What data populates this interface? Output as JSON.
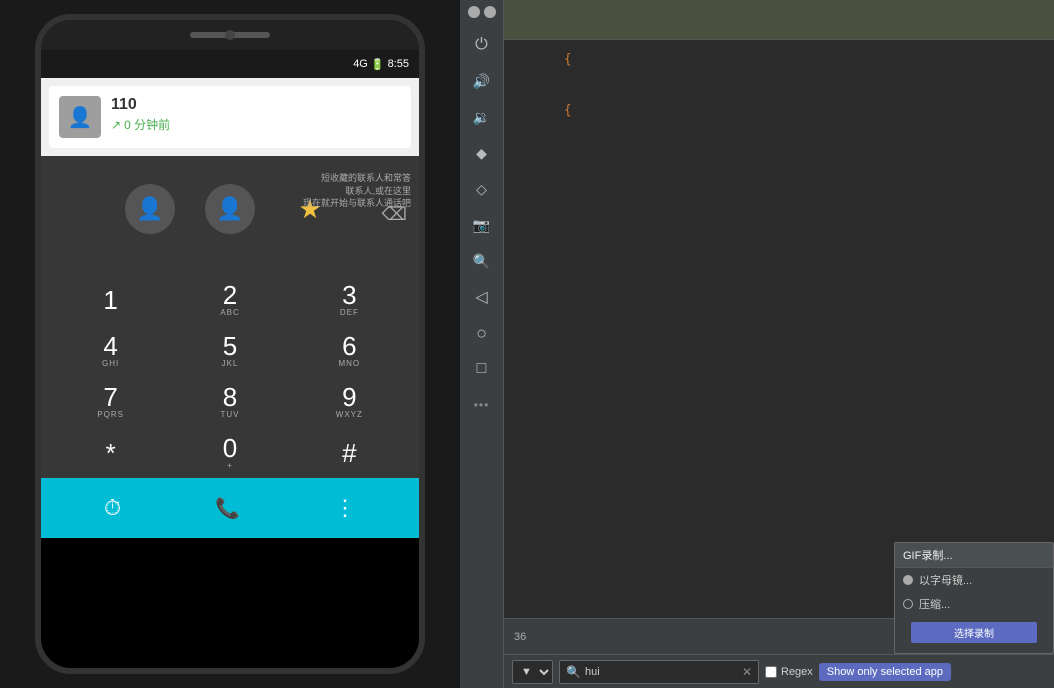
{
  "phone": {
    "status_bar": {
      "time": "8:55",
      "icons": "4G ▪ 🔋"
    },
    "notification": {
      "caller_number": "110",
      "time_ago": "0 分钟前",
      "avatar_icon": "👤"
    },
    "dialpad": {
      "overlay_text_line1": "短收藏的联系人和常答",
      "overlay_text_line2": "联系人,或在这里",
      "overlay_text_line3": "现在就开始与联系人通话吧",
      "keys": [
        {
          "num": "1",
          "letters": ""
        },
        {
          "num": "2",
          "letters": "ABC"
        },
        {
          "num": "3",
          "letters": "DEF"
        },
        {
          "num": "4",
          "letters": "GHI"
        },
        {
          "num": "5",
          "letters": "JKL"
        },
        {
          "num": "6",
          "letters": "MNO"
        },
        {
          "num": "7",
          "letters": "PQRS"
        },
        {
          "num": "8",
          "letters": "TUV"
        },
        {
          "num": "9",
          "letters": "WXYZ"
        },
        {
          "num": "*",
          "letters": ""
        },
        {
          "num": "0",
          "letters": "+"
        },
        {
          "num": "#",
          "letters": ""
        }
      ]
    },
    "bottom_bar": {
      "left_icon": "⏱",
      "center_icon": "📞",
      "right_icon": "⋮"
    }
  },
  "ide": {
    "toolbar": {
      "minimize_label": "–",
      "close_label": "✕",
      "icons": [
        {
          "name": "power-icon",
          "symbol": "⏻"
        },
        {
          "name": "volume-up-icon",
          "symbol": "🔊"
        },
        {
          "name": "volume-down-icon",
          "symbol": "🔉"
        },
        {
          "name": "diamond-icon",
          "symbol": "◆"
        },
        {
          "name": "eraser-icon",
          "symbol": "◇"
        },
        {
          "name": "camera-icon",
          "symbol": "📷"
        },
        {
          "name": "zoom-in-icon",
          "symbol": "🔍"
        },
        {
          "name": "back-icon",
          "symbol": "◁"
        },
        {
          "name": "home-icon",
          "symbol": "○"
        },
        {
          "name": "square-icon",
          "symbol": "□"
        },
        {
          "name": "more-icon",
          "symbol": "•••"
        }
      ]
    },
    "header": {
      "background": "#4a5040"
    },
    "code": {
      "line1": "{",
      "line2": "{"
    },
    "bottom": {
      "line_number": "36"
    },
    "search": {
      "dropdown_value": "▼",
      "input_value": "hui",
      "input_placeholder": "Search",
      "clear_btn": "✕",
      "regex_label": "Regex",
      "show_selected_label": "Show only selected app"
    },
    "context_menu": {
      "header": "GIF录制...",
      "items": [
        {
          "label": "以字母镜...",
          "type": "radio",
          "checked": false
        },
        {
          "label": "压缩...",
          "type": "radio",
          "checked": false
        }
      ],
      "action_btn": "选择录制"
    }
  }
}
